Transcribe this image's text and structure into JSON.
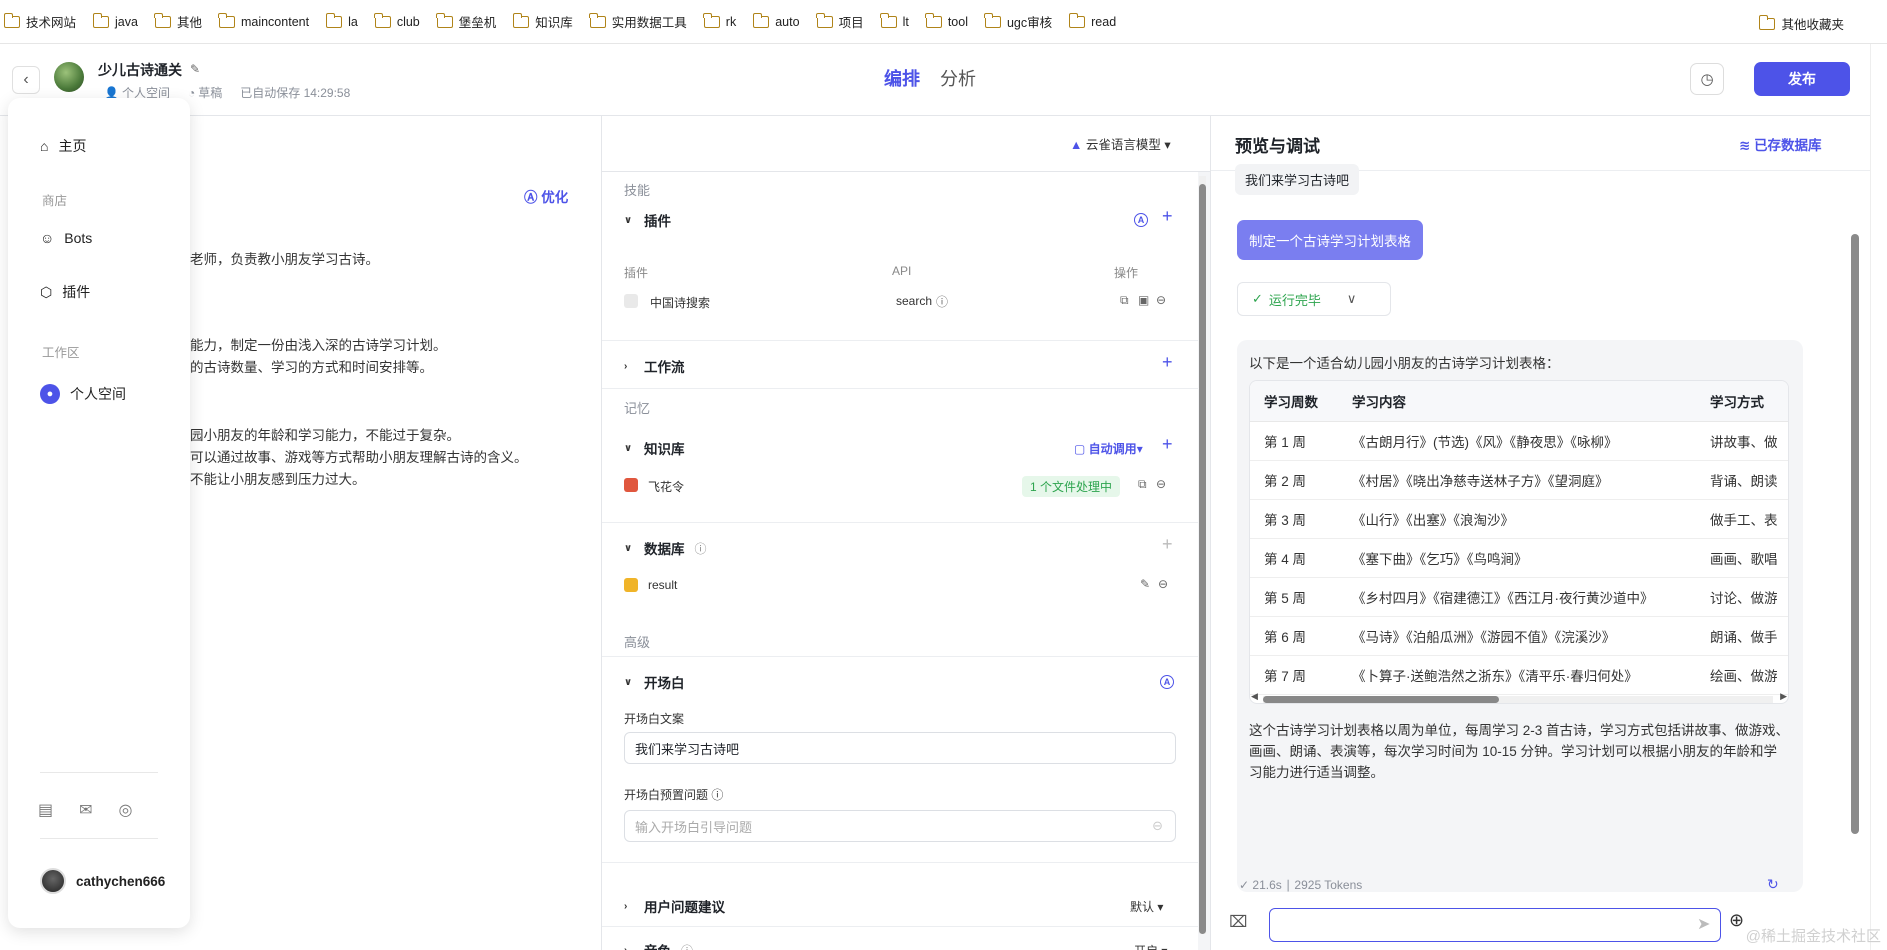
{
  "bookmarks": {
    "items": [
      "技术网站",
      "java",
      "其他",
      "maincontent",
      "la",
      "club",
      "堡垒机",
      "知识库",
      "实用数据工具",
      "rk",
      "auto",
      "项目",
      "lt",
      "tool",
      "ugc审核",
      "read"
    ],
    "other": "其他收藏夹"
  },
  "header": {
    "bot_name": "少儿古诗通关",
    "workspace": "个人空间",
    "draft": "草稿",
    "autosave": "已自动保存 14:29:58",
    "tab_edit": "编排",
    "tab_analyze": "分析",
    "publish": "发布"
  },
  "sidebar": {
    "home": "主页",
    "store_label": "商店",
    "bots": "Bots",
    "plugins": "插件",
    "workspace_label": "工作区",
    "personal_space": "个人空间",
    "username": "cathychen666"
  },
  "prompt": {
    "optimize": "优化",
    "lines": [
      "老师，负责教小朋友学习古诗。",
      "能力，制定一份由浅入深的古诗学习计划。",
      "的古诗数量、学习的方式和时间安排等。",
      "园小朋友的年龄和学习能力，不能过于复杂。",
      "可以通过故事、游戏等方式帮助小朋友理解古诗的含义。",
      "不能让小朋友感到压力过大。"
    ]
  },
  "config": {
    "model": "云雀语言模型",
    "skills_label": "技能",
    "plugins_title": "插件",
    "col_plugin": "插件",
    "col_api": "API",
    "col_ops": "操作",
    "plugin_name": "中国诗搜索",
    "plugin_api": "search",
    "workflow_title": "工作流",
    "memory_label": "记忆",
    "kb_title": "知识库",
    "kb_auto": "自动调用",
    "kb_name": "飞花令",
    "kb_badge": "1 个文件处理中",
    "db_title": "数据库",
    "db_name": "result",
    "advanced_label": "高级",
    "opening_title": "开场白",
    "opening_text_label": "开场白文案",
    "opening_text_value": "我们来学习古诗吧",
    "opening_q_label": "开场白预置问题",
    "opening_q_placeholder": "输入开场白引导问题",
    "suggest_title": "用户问题建议",
    "suggest_value": "默认",
    "voice_title": "音色",
    "voice_value": "开启"
  },
  "preview": {
    "title": "预览与调试",
    "db_saved": "已存数据库",
    "user_msg": "我们来学习古诗吧",
    "suggest_btn": "制定一个古诗学习计划表格",
    "run_state": "运行完毕",
    "intro": "以下是一个适合幼儿园小朋友的古诗学习计划表格：",
    "table": {
      "headers": [
        "学习周数",
        "学习内容",
        "学习方式"
      ],
      "rows": [
        [
          "第 1 周",
          "《古朗月行》(节选)《风》《静夜思》《咏柳》",
          "讲故事、做"
        ],
        [
          "第 2 周",
          "《村居》《晓出净慈寺送林子方》《望洞庭》",
          "背诵、朗读"
        ],
        [
          "第 3 周",
          "《山行》《出塞》《浪淘沙》",
          "做手工、表"
        ],
        [
          "第 4 周",
          "《塞下曲》《乞巧》《鸟鸣涧》",
          "画画、歌唱"
        ],
        [
          "第 5 周",
          "《乡村四月》《宿建德江》《西江月·夜行黄沙道中》",
          "讨论、做游"
        ],
        [
          "第 6 周",
          "《马诗》《泊船瓜洲》《游园不值》《浣溪沙》",
          "朗诵、做手"
        ],
        [
          "第 7 周",
          "《卜算子·送鲍浩然之浙东》《清平乐·春归何处》",
          "绘画、做游"
        ]
      ]
    },
    "summary": "这个古诗学习计划表格以周为单位，每周学习 2-3 首古诗，学习方式包括讲故事、做游戏、画画、朗诵、表演等，每次学习时间为 10-15 分钟。学习计划可以根据小朋友的年龄和学习能力进行适当调整。",
    "time": "21.6s",
    "tokens": "2925 Tokens"
  },
  "watermark": "@稀土掘金技术社区"
}
